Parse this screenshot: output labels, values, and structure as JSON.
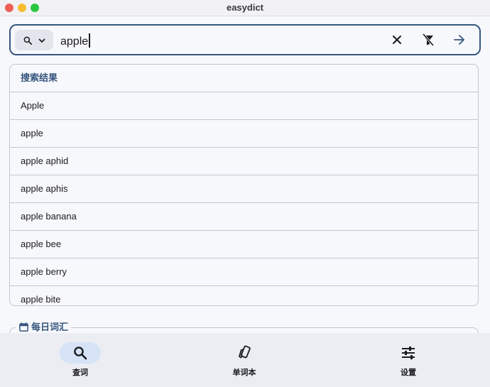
{
  "window": {
    "title": "easydict"
  },
  "search": {
    "mode_icon": "search-icon",
    "query": "apple",
    "actions": [
      "close-icon",
      "filter-off-icon",
      "arrow-right-icon"
    ]
  },
  "results": {
    "header": "搜索结果",
    "items": [
      "Apple",
      "apple",
      "apple aphid",
      "apple aphis",
      "apple banana",
      "apple bee",
      "apple berry",
      "apple bite"
    ]
  },
  "daily": {
    "title": "每日词汇",
    "icon": "calendar-icon"
  },
  "nav": {
    "items": [
      {
        "label": "查词",
        "icon": "search-icon",
        "active": true
      },
      {
        "label": "单词本",
        "icon": "cards-icon",
        "active": false
      },
      {
        "label": "设置",
        "icon": "sliders-icon",
        "active": false
      }
    ]
  },
  "colors": {
    "accent": "#36567e",
    "active_pill": "#d6e3f7",
    "nav_bg": "#ebedf3"
  }
}
